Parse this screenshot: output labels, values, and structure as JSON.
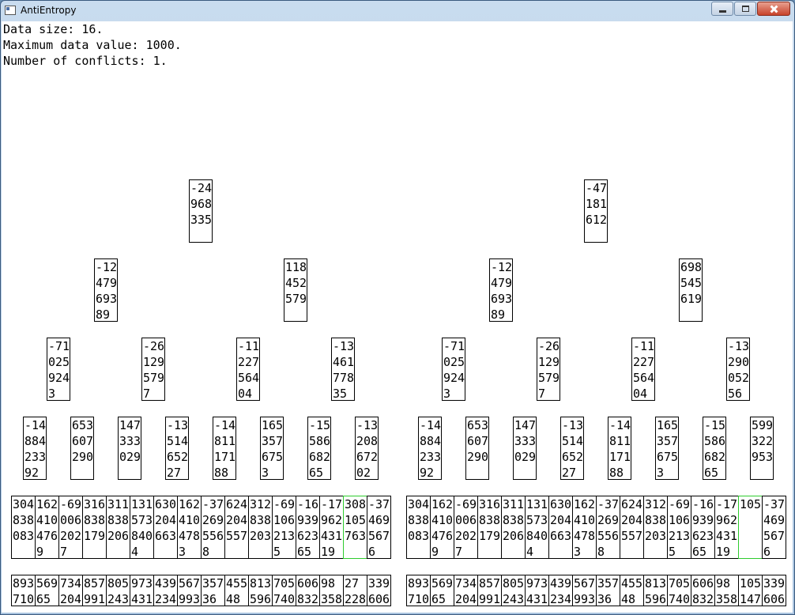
{
  "window": {
    "title": "AntiEntropy"
  },
  "info": {
    "data_size": "Data size: 16.",
    "max_value": "Maximum data value: 1000.",
    "conflicts": "Number of conflicts: 1."
  },
  "trees": [
    {
      "root": "-24\n968\n335",
      "level1": [
        "-12\n479\n693\n89",
        "118\n452\n579"
      ],
      "level2": [
        "-71\n025\n924\n3",
        "-26\n129\n579\n7",
        "-11\n227\n564\n04",
        "-13\n461\n778\n35"
      ],
      "level3": [
        "-14\n884\n233\n92",
        "653\n607\n290",
        "147\n333\n029",
        "-13\n514\n652\n27",
        "-14\n811\n171\n88",
        "165\n357\n675\n3",
        "-15\n586\n682\n65",
        "-13\n208\n672\n02"
      ],
      "leaves": [
        "304\n838\n083",
        "162\n410\n476\n9",
        "-69\n006\n202\n7",
        "316\n838\n179",
        "311\n838\n206",
        "131\n573\n840\n4",
        "630\n204\n663",
        "162\n410\n478\n3",
        "-37\n269\n556\n8",
        "624\n204\n557",
        "312\n838\n203",
        "-69\n106\n213\n5",
        "-16\n939\n623\n65",
        "-17\n962\n431\n19",
        "308\n105\n763",
        "-37\n469\n567\n6"
      ],
      "data": [
        "893\n710",
        "569\n65",
        "734\n204",
        "857\n991",
        "805\n243",
        "973\n431",
        "439\n234",
        "567\n993",
        "357\n36",
        "455\n48",
        "813\n596",
        "705\n740",
        "606\n832",
        "98\n358",
        "27\n228",
        "339\n606"
      ],
      "conflict_index": 14
    },
    {
      "root": "-47\n181\n612",
      "level1": [
        "-12\n479\n693\n89",
        "698\n545\n619"
      ],
      "level2": [
        "-71\n025\n924\n3",
        "-26\n129\n579\n7",
        "-11\n227\n564\n04",
        "-13\n290\n052\n56"
      ],
      "level3": [
        "-14\n884\n233\n92",
        "653\n607\n290",
        "147\n333\n029",
        "-13\n514\n652\n27",
        "-14\n811\n171\n88",
        "165\n357\n675\n3",
        "-15\n586\n682\n65",
        "599\n322\n953"
      ],
      "leaves": [
        "304\n838\n083",
        "162\n410\n476\n9",
        "-69\n006\n202\n7",
        "316\n838\n179",
        "311\n838\n206",
        "131\n573\n840\n4",
        "630\n204\n663",
        "162\n410\n478\n3",
        "-37\n269\n556\n8",
        "624\n204\n557",
        "312\n838\n203",
        "-69\n106\n213\n5",
        "-16\n939\n623\n65",
        "-17\n962\n431\n19",
        "105",
        "-37\n469\n567\n6"
      ],
      "data": [
        "893\n710",
        "569\n65",
        "734\n204",
        "857\n991",
        "805\n243",
        "973\n431",
        "439\n234",
        "567\n993",
        "357\n36",
        "455\n48",
        "813\n596",
        "705\n740",
        "606\n832",
        "98\n358",
        "105\n147",
        "339\n606"
      ],
      "conflict_index": 14
    }
  ]
}
